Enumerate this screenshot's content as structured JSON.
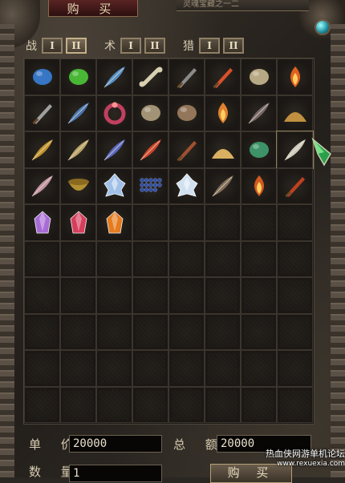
{
  "window": {
    "title": "购 买",
    "subtitle": "灵魂宝藏之一二"
  },
  "tab_groups": [
    {
      "label": "战",
      "tabs": [
        "I",
        "II"
      ],
      "active_index": 1
    },
    {
      "label": "术",
      "tabs": [
        "I",
        "II"
      ],
      "active_index": -1
    },
    {
      "label": "猎",
      "tabs": [
        "I",
        "II"
      ],
      "active_index": -1
    }
  ],
  "grid": {
    "columns": 8,
    "rows": 10,
    "items": [
      {
        "icon": "blue-cloud-icon",
        "color": "#3a7fd8"
      },
      {
        "icon": "green-slime-icon",
        "color": "#4ec83a"
      },
      {
        "icon": "blue-feather-icon",
        "color": "#5a9ad8"
      },
      {
        "icon": "bone-icon",
        "color": "#d8d0b0"
      },
      {
        "icon": "dagger-icon",
        "color": "#8a8a8a"
      },
      {
        "icon": "red-sword-icon",
        "color": "#d8502a"
      },
      {
        "icon": "horn-icon",
        "color": "#c8b890"
      },
      {
        "icon": "fire-torch-icon",
        "color": "#e06020"
      },
      {
        "icon": "scythe-icon",
        "color": "#a0a0a0"
      },
      {
        "icon": "rainbow-feather-icon",
        "color": "#5080c0"
      },
      {
        "icon": "ruby-ring-icon",
        "color": "#c04060"
      },
      {
        "icon": "claw-icon",
        "color": "#b0a080"
      },
      {
        "icon": "fur-tuft-icon",
        "color": "#a08060"
      },
      {
        "icon": "flame-orb-icon",
        "color": "#e08030"
      },
      {
        "icon": "bat-wing-icon",
        "color": "#807070"
      },
      {
        "icon": "ore-icon",
        "color": "#c09040"
      },
      {
        "icon": "golden-feather-icon",
        "color": "#d0a030"
      },
      {
        "icon": "wheat-icon",
        "color": "#c8b070"
      },
      {
        "icon": "prism-feather-icon",
        "color": "#6070d0"
      },
      {
        "icon": "phoenix-feather-icon",
        "color": "#e04a30"
      },
      {
        "icon": "branch-icon",
        "color": "#a05030"
      },
      {
        "icon": "sand-pile-icon",
        "color": "#d8b060"
      },
      {
        "icon": "jade-dragon-icon",
        "color": "#40a070"
      },
      {
        "icon": "white-fang-icon",
        "color": "#e0e0d0"
      },
      {
        "icon": "pink-wing-icon",
        "color": "#d0a0b0"
      },
      {
        "icon": "gold-bowl-icon",
        "color": "#b09030"
      },
      {
        "icon": "ice-crystal-icon",
        "color": "#a0c0e8"
      },
      {
        "icon": "blue-beads-icon",
        "color": "#3050a0"
      },
      {
        "icon": "white-crystal-icon",
        "color": "#d0e0f0"
      },
      {
        "icon": "brown-feather-icon",
        "color": "#8a7560"
      },
      {
        "icon": "flame-lamp-icon",
        "color": "#d05a20"
      },
      {
        "icon": "fire-hook-icon",
        "color": "#c04020"
      },
      {
        "icon": "purple-gem-icon",
        "color": "#b070e0"
      },
      {
        "icon": "red-gem-icon",
        "color": "#e04060"
      },
      {
        "icon": "orange-gem-icon",
        "color": "#f08020"
      }
    ]
  },
  "footer": {
    "unit_price_label": "单 价",
    "unit_price_value": "20000",
    "total_label": "总 额",
    "total_value": "20000",
    "quantity_label": "数 量",
    "quantity_value": "1",
    "buy_button": "购 买"
  },
  "watermark": {
    "line1": "热血侠网游单机论坛",
    "line2": "www.rexuexia.com"
  }
}
